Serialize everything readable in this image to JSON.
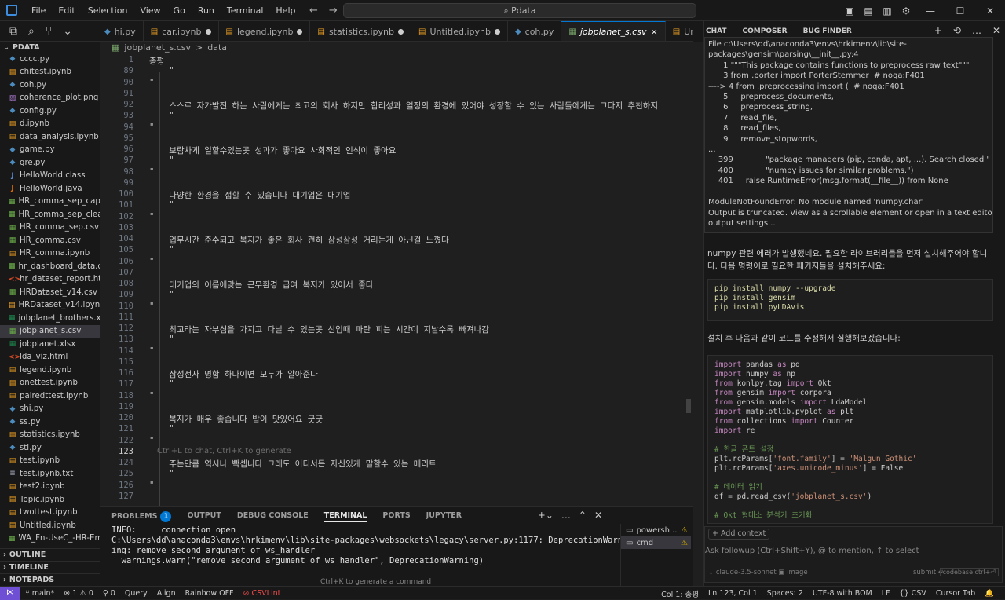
{
  "menu": [
    "File",
    "Edit",
    "Selection",
    "View",
    "Go",
    "Run",
    "Terminal",
    "Help"
  ],
  "search": {
    "label": "Pdata"
  },
  "tabs": [
    {
      "label": "hi.py",
      "icon": "python",
      "dot": false
    },
    {
      "label": "car.ipynb",
      "icon": "notebook",
      "dot": true
    },
    {
      "label": "legend.ipynb",
      "icon": "notebook",
      "dot": true
    },
    {
      "label": "statistics.ipynb",
      "icon": "notebook",
      "dot": true
    },
    {
      "label": "Untitled.ipynb",
      "icon": "notebook",
      "dot": true
    },
    {
      "label": "coh.py",
      "icon": "python",
      "dot": false
    },
    {
      "label": "jobplanet_s.csv",
      "icon": "csv",
      "dot": false,
      "active": true,
      "close": "×"
    },
    {
      "label": "Unti",
      "icon": "notebook",
      "dot": false
    }
  ],
  "explorer": {
    "title": "PDATA",
    "files": [
      {
        "name": "cccc.py",
        "type": "py"
      },
      {
        "name": "chitest.ipynb",
        "type": "nb"
      },
      {
        "name": "coh.py",
        "type": "py"
      },
      {
        "name": "coherence_plot.png",
        "type": "img"
      },
      {
        "name": "config.py",
        "type": "py"
      },
      {
        "name": "d.ipynb",
        "type": "nb"
      },
      {
        "name": "data_analysis.ipynb",
        "type": "nb"
      },
      {
        "name": "game.py",
        "type": "py"
      },
      {
        "name": "gre.py",
        "type": "py"
      },
      {
        "name": "HelloWorld.class",
        "type": "class"
      },
      {
        "name": "HelloWorld.java",
        "type": "java"
      },
      {
        "name": "HR_comma_sep_capp...",
        "type": "csv"
      },
      {
        "name": "HR_comma_sep_clean...",
        "type": "csv"
      },
      {
        "name": "HR_comma_sep.csv",
        "type": "csv"
      },
      {
        "name": "HR_comma.csv",
        "type": "csv"
      },
      {
        "name": "HR_comma.ipynb",
        "type": "nb"
      },
      {
        "name": "hr_dashboard_data.csv",
        "type": "csv"
      },
      {
        "name": "hr_dataset_report.html",
        "type": "html"
      },
      {
        "name": "HRDataset_v14.csv",
        "type": "csv"
      },
      {
        "name": "HRDataset_v14.ipynb...",
        "type": "nb"
      },
      {
        "name": "jobplanet_brothers.xlsx",
        "type": "xlsx"
      },
      {
        "name": "jobplanet_s.csv",
        "type": "csv",
        "active": true
      },
      {
        "name": "jobplanet.xlsx",
        "type": "xlsx"
      },
      {
        "name": "lda_viz.html",
        "type": "html"
      },
      {
        "name": "legend.ipynb",
        "type": "nb"
      },
      {
        "name": "onettest.ipynb",
        "type": "nb"
      },
      {
        "name": "pairedttest.ipynb",
        "type": "nb"
      },
      {
        "name": "shi.py",
        "type": "py"
      },
      {
        "name": "ss.py",
        "type": "py"
      },
      {
        "name": "statistics.ipynb",
        "type": "nb"
      },
      {
        "name": "stl.py",
        "type": "py"
      },
      {
        "name": "test.ipynb",
        "type": "nb"
      },
      {
        "name": "test.ipynb.txt",
        "type": "txt"
      },
      {
        "name": "test2.ipynb",
        "type": "nb"
      },
      {
        "name": "Topic.ipynb",
        "type": "nb"
      },
      {
        "name": "twottest.ipynb",
        "type": "nb"
      },
      {
        "name": "Untitled.ipynb",
        "type": "nb"
      },
      {
        "name": "WA_Fn-UseC_-HR-Em...",
        "type": "csv"
      }
    ],
    "sections": [
      "OUTLINE",
      "TIMELINE",
      "NOTEPADS"
    ]
  },
  "breadcrumb": {
    "file": "jobplanet_s.csv",
    "sep": ">",
    "symbol": "data"
  },
  "editor": {
    "lines": [
      {
        "n": "1",
        "t": "총평"
      },
      {
        "n": "89",
        "t": "    \""
      },
      {
        "n": "90",
        "t": "\""
      },
      {
        "n": "91",
        "t": ""
      },
      {
        "n": "92",
        "t": "    스스로 자가발전 하는 사람에게는 최고의 회사 하지만 합리성과 열정의 환경에 있어야 성장할 수 있는 사람들에게는 그다지 추천하지"
      },
      {
        "n": "93",
        "t": "    \""
      },
      {
        "n": "94",
        "t": "\""
      },
      {
        "n": "95",
        "t": ""
      },
      {
        "n": "96",
        "t": "    보람차게 일할수있는곳 성과가 좋아요 사회적인 인식이 좋아요"
      },
      {
        "n": "97",
        "t": "    \""
      },
      {
        "n": "98",
        "t": "\""
      },
      {
        "n": "99",
        "t": ""
      },
      {
        "n": "100",
        "t": "    다양한 환경을 접할 수 있습니다 대기업은 대기업"
      },
      {
        "n": "101",
        "t": "    \""
      },
      {
        "n": "102",
        "t": "\""
      },
      {
        "n": "103",
        "t": ""
      },
      {
        "n": "104",
        "t": "    업무시간 준수되고 복지가 좋은 회사 괜히 삼성삼성 거리는게 아닌걸 느꼈다"
      },
      {
        "n": "105",
        "t": "    \""
      },
      {
        "n": "106",
        "t": "\""
      },
      {
        "n": "107",
        "t": ""
      },
      {
        "n": "108",
        "t": "    대기업의 이름에맞는 근무환경 급여 복지가 있어서 좋다"
      },
      {
        "n": "109",
        "t": "    \""
      },
      {
        "n": "110",
        "t": "\""
      },
      {
        "n": "111",
        "t": ""
      },
      {
        "n": "112",
        "t": "    최고라는 자부심을 가지고 다닐 수 있는곳 신입때 파란 피는 시간이 지날수록 빠져나감"
      },
      {
        "n": "113",
        "t": "    \""
      },
      {
        "n": "114",
        "t": "\""
      },
      {
        "n": "115",
        "t": ""
      },
      {
        "n": "116",
        "t": "    삼성전자 명함 하나이면 모두가 알아준다"
      },
      {
        "n": "117",
        "t": "    \""
      },
      {
        "n": "118",
        "t": "\""
      },
      {
        "n": "119",
        "t": ""
      },
      {
        "n": "120",
        "t": "    복지가 매우 좋습니다 밥이 맛있어요 굿굿"
      },
      {
        "n": "121",
        "t": "    \""
      },
      {
        "n": "122",
        "t": "\""
      },
      {
        "n": "123",
        "t": "Ctrl+L to chat, Ctrl+K to generate",
        "hint": true
      },
      {
        "n": "124",
        "t": "    주는만큼 역시나 빡셉니다 그래도 어디서든 자신있게 말할수 있는 메리트"
      },
      {
        "n": "125",
        "t": "    \""
      },
      {
        "n": "126",
        "t": "\""
      },
      {
        "n": "127",
        "t": ""
      }
    ]
  },
  "panel": {
    "tabs": [
      "PROBLEMS",
      "OUTPUT",
      "DEBUG CONSOLE",
      "TERMINAL",
      "PORTS",
      "JUPYTER"
    ],
    "problems_count": "1",
    "terminal_text": "INFO:     connection open\nC:\\Users\\dd\\anaconda3\\envs\\hrkimenv\\lib\\site-packages\\websockets\\legacy\\server.py:1177: DeprecationWarning: remove second argument of ws_handler\n  warnings.warn(\"remove second argument of ws_handler\", DeprecationWarning)",
    "hint": "Ctrl+K to generate a command",
    "terminals": [
      "powersh...",
      "cmd"
    ]
  },
  "chat": {
    "tabs": [
      "CHAT",
      "COMPOSER",
      "BUG FINDER"
    ],
    "output": "File c:\\Users\\dd\\anaconda3\\envs\\hrkimenv\\lib\\site-\npackages\\gensim\\parsing\\__init__.py:4\n      1 \"\"\"This package contains functions to preprocess raw text\"\"\"\n      3 from .porter import PorterStemmer  # noqa:F401\n----> 4 from .preprocessing import (  # noqa:F401\n      5     preprocess_documents,\n      6     preprocess_string,\n      7     read_file,\n      8     read_files,\n      9     remove_stopwords,\n...\n    399             \"package managers (pip, conda, apt, ...). Search closed \"\n    400             \"numpy issues for similar problems.\")\n    401     raise RuntimeError(msg.format(__file__)) from None\n\nModuleNotFoundError: No module named 'numpy.char'\nOutput is truncated. View as a scrollable element or open in a text editor. Adjust cell\noutput settings...",
    "msg1": "numpy 관련 에러가 발생했네요. 필요한 라이브러리들을 먼저 설치해주어야 합니다. 다음 명령어로 필요한 패키지들을 설치해주세요:",
    "pip": [
      "pip install numpy --upgrade",
      "pip install gensim",
      "pip install pyLDAvis"
    ],
    "msg2": "설치 후 다음과 같이 코드를 수정해서 실행해보겠습니다:",
    "code": [
      "import pandas as pd",
      "import numpy as np",
      "from konlpy.tag import Okt",
      "from gensim import corpora",
      "from gensim.models import LdaModel",
      "import matplotlib.pyplot as plt",
      "from collections import Counter",
      "import re",
      "",
      "# 한글 폰트 설정",
      "plt.rcParams['font.family'] = 'Malgun Gothic'",
      "plt.rcParams['axes.unicode_minus'] = False",
      "",
      "# 데이터 읽기",
      "df = pd.read_csv('jobplanet_s.csv')",
      "",
      "# Okt 형태소 분석기 초기화"
    ],
    "add_context": "+ Add context",
    "input_placeholder": "Ask followup (Ctrl+Shift+Y), @ to mention, ↑ to select",
    "model": "⌄ claude-3.5-sonnet   ▣ image",
    "submit": "submit ↵",
    "codebase": "codebase ctrl+⏎"
  },
  "status": {
    "branch": "main*",
    "errors": "⊗ 1 ⚠ 0",
    "ports": "⚲ 0",
    "left_items": [
      "Query",
      "Align",
      "Rainbow OFF"
    ],
    "csvlint": "⊘ CSVLint",
    "right_items": [
      "Col 1: 총평",
      "Ln 123, Col 1",
      "Spaces: 2",
      "UTF-8 with BOM",
      "LF",
      "{} CSV",
      "Cursor Tab",
      "🔔"
    ]
  },
  "colors": {
    "accent": "#0078d4",
    "remote": "#6f4fd4",
    "string": "#ce9178",
    "keyword": "#c586c0",
    "comment": "#6a9955"
  }
}
